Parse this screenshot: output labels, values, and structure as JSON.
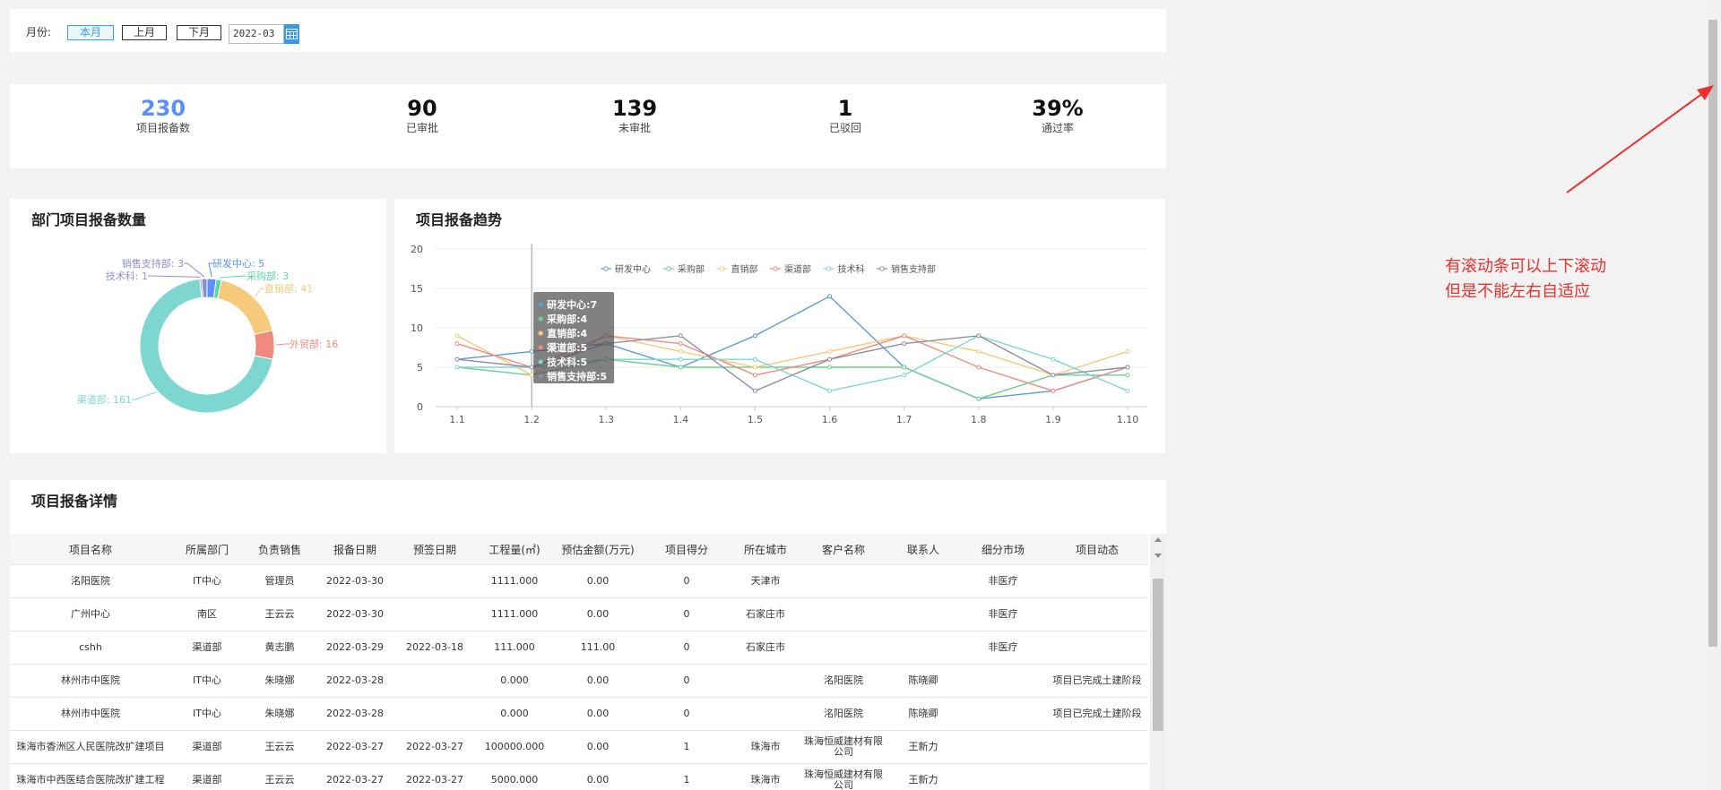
{
  "filter": {
    "label": "月份:",
    "buttons": [
      "本月",
      "上月",
      "下月"
    ],
    "month_value": "2022-03"
  },
  "stats": [
    {
      "value": "230",
      "label": "项目报备数"
    },
    {
      "value": "90",
      "label": "已审批"
    },
    {
      "value": "139",
      "label": "未审批"
    },
    {
      "value": "1",
      "label": "已驳回"
    },
    {
      "value": "39%",
      "label": "通过率"
    }
  ],
  "dept_panel": {
    "title": "部门项目报备数量"
  },
  "trend_panel": {
    "title": "项目报备趋势"
  },
  "detail_panel": {
    "title": "项目报备详情"
  },
  "chart_data": [
    {
      "type": "pie",
      "variant": "donut",
      "slices": [
        {
          "name": "研发中心",
          "value": 5,
          "color": "#5b8ff9"
        },
        {
          "name": "采购部",
          "value": 3,
          "color": "#5ad8a6"
        },
        {
          "name": "直销部",
          "value": 41,
          "color": "#f6c97b"
        },
        {
          "name": "外贸部",
          "value": 16,
          "color": "#f08a7e"
        },
        {
          "name": "渠道部",
          "value": 161,
          "color": "#7ed6d0"
        },
        {
          "name": "技术科",
          "value": 1,
          "color": "#8f93d6"
        },
        {
          "name": "销售支持部",
          "value": 3,
          "color": "#8b8fc8"
        }
      ]
    },
    {
      "type": "line",
      "x": [
        "1.1",
        "1.2",
        "1.3",
        "1.4",
        "1.5",
        "1.6",
        "1.7",
        "1.8",
        "1.9",
        "1.10"
      ],
      "ylim": [
        0,
        20
      ],
      "yticks": [
        0,
        5,
        10,
        15,
        20
      ],
      "legend_position": "top",
      "series": [
        {
          "name": "研发中心",
          "color": "#5b9bd5",
          "values": [
            6,
            7,
            8,
            5,
            9,
            14,
            5,
            1,
            2,
            5
          ]
        },
        {
          "name": "采购部",
          "color": "#6fd08c",
          "values": [
            5,
            4,
            6,
            5,
            5,
            5,
            5,
            1,
            4,
            4
          ]
        },
        {
          "name": "直销部",
          "color": "#f6c97b",
          "values": [
            9,
            4,
            9,
            7,
            5,
            7,
            9,
            7,
            4,
            7
          ]
        },
        {
          "name": "渠道部",
          "color": "#f08a7e",
          "values": [
            8,
            5,
            9,
            8,
            4,
            6,
            9,
            5,
            2,
            5
          ]
        },
        {
          "name": "技术科",
          "color": "#7ed6d0",
          "values": [
            5,
            5,
            6,
            6,
            6,
            2,
            4,
            9,
            6,
            2
          ]
        },
        {
          "name": "销售支持部",
          "color": "#8d8fa8",
          "values": [
            6,
            5,
            8,
            9,
            2,
            6,
            8,
            9,
            4,
            5
          ]
        }
      ],
      "tooltip": {
        "x": "1.2",
        "lines": [
          "研发中心:7",
          "采购部:4",
          "直销部:4",
          "渠道部:5",
          "技术科:5",
          "销售支持部:5"
        ]
      }
    }
  ],
  "table": {
    "columns": [
      "项目名称",
      "所属部门",
      "负责销售",
      "报备日期",
      "预签日期",
      "工程量(㎡)",
      "预估金额(万元)",
      "项目得分",
      "所在城市",
      "客户名称",
      "联系人",
      "细分市场",
      "项目动态"
    ],
    "rows": [
      [
        "洺阳医院",
        "IT中心",
        "管理员",
        "2022-03-30",
        "",
        "1111.000",
        "0.00",
        "0",
        "天津市",
        "",
        "",
        "非医疗",
        ""
      ],
      [
        "广州中心",
        "南区",
        "王云云",
        "2022-03-30",
        "",
        "1111.000",
        "0.00",
        "0",
        "石家庄市",
        "",
        "",
        "非医疗",
        ""
      ],
      [
        "cshh",
        "渠道部",
        "黄志鹏",
        "2022-03-29",
        "2022-03-18",
        "111.000",
        "111.00",
        "0",
        "石家庄市",
        "",
        "",
        "非医疗",
        ""
      ],
      [
        "林州市中医院",
        "IT中心",
        "朱晓娜",
        "2022-03-28",
        "",
        "0.000",
        "0.00",
        "0",
        "",
        "洺阳医院",
        "陈晓卿",
        "",
        "项目已完成土建阶段"
      ],
      [
        "林州市中医院",
        "IT中心",
        "朱晓娜",
        "2022-03-28",
        "",
        "0.000",
        "0.00",
        "0",
        "",
        "洺阳医院",
        "陈晓卿",
        "",
        "项目已完成土建阶段"
      ],
      [
        "珠海市香洲区人民医院改扩建项目",
        "渠道部",
        "王云云",
        "2022-03-27",
        "2022-03-27",
        "100000.000",
        "0.00",
        "1",
        "珠海市",
        "珠海恒威建材有限公司",
        "王新力",
        "",
        ""
      ],
      [
        "珠海市中西医结合医院改扩建工程",
        "渠道部",
        "王云云",
        "2022-03-27",
        "2022-03-27",
        "5000.000",
        "0.00",
        "1",
        "珠海市",
        "珠海恒威建材有限公司",
        "王新力",
        "",
        ""
      ]
    ]
  },
  "annotation": "有滚动条可以上下滚动\n但是不能左右自适应"
}
